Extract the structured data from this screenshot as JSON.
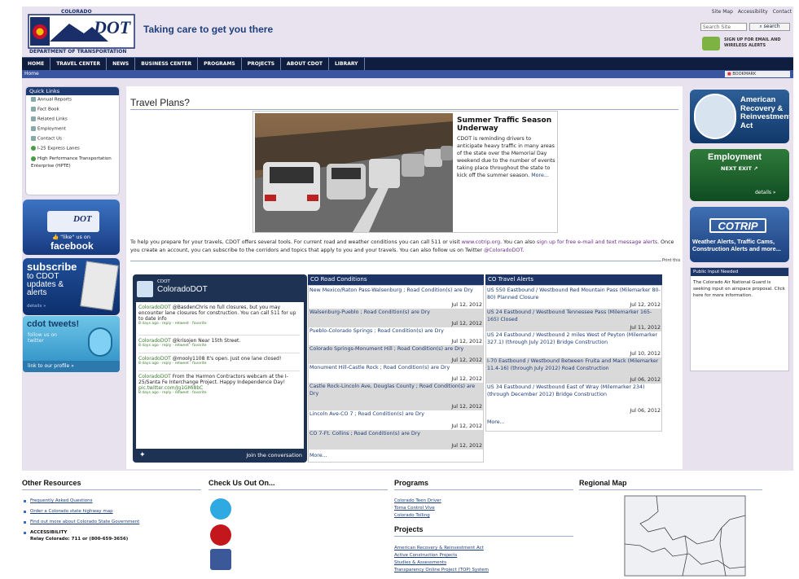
{
  "header": {
    "logo_state": "COLORADO",
    "logo_main": "DOT",
    "logo_dept": "DEPARTMENT OF TRANSPORTATION",
    "tagline": "Taking care to get you there",
    "top_links": [
      "Site Map",
      "Accessibility",
      "Contact"
    ],
    "search_placeholder": "Search Site",
    "search_button": "search",
    "signup": "SIGN UP FOR EMAIL AND WIRELESS ALERTS"
  },
  "nav": {
    "items": [
      "HOME",
      "TRAVEL CENTER",
      "NEWS",
      "BUSINESS CENTER",
      "PROGRAMS",
      "PROJECTS",
      "ABOUT CDOT",
      "LIBRARY"
    ]
  },
  "breadcrumb": {
    "home": "Home",
    "bookmark": "BOOKMARK"
  },
  "quick_links": {
    "title": "Quick Links",
    "items": [
      "Annual Reports",
      "Fact Book",
      "Related Links",
      "Employment",
      "Contact Us",
      "I-25 Express Lanes",
      "High Performance Transportation Enterprise (HPTE)"
    ]
  },
  "left_promos": {
    "facebook_line1": "\"like\" us on",
    "facebook_line2": "facebook",
    "facebook_logo": "DOT",
    "subscribe_title": "subscribe",
    "subscribe_lines": [
      "to CDOT",
      "updates &",
      "alerts"
    ],
    "subscribe_details": "details »",
    "tweets_title": "cdot tweets!",
    "tweets_sub": "follow us on twitter",
    "tweets_link": "link to our profile »"
  },
  "main": {
    "title": "Travel Plans?",
    "feature_title": "Summer Traffic Season Underway",
    "feature_text": "CDOT is reminding drivers to anticipate heavy traffic in many areas of the state over the Memorial Day weekend due to the number of events taking place throughout the state to kick off the summer season.",
    "feature_more": "More...",
    "intro_a": "To help you prepare for your travels, CDOT offers several tools. For current road and weather conditions you can call 511 or visit ",
    "intro_link1": "www.cotrip.org",
    "intro_b": ". You can also ",
    "intro_link2": "sign up for free e-mail and text message alerts",
    "intro_c": ". Once you create an account, you can subscribe to the corridors and topics that apply to you and your travels. You can also follow us on Twitter ",
    "intro_link3": "@ColoradoDOT",
    "intro_d": ".",
    "print_this": "Print this"
  },
  "twitter_widget": {
    "small": "CDOT",
    "name": "ColoradoDOT",
    "join": "Join the conversation",
    "tweets": [
      {
        "user": "ColoradoDOT",
        "text": " @BasdenChris no full closures, but you may encounter lane closures for construction. You can call 511 for up to date info",
        "meta": "8 days ago · reply · retweet · favorite"
      },
      {
        "user": "ColoradoDOT",
        "text": " @krisojen Near 15th Street.",
        "meta": "8 days ago · reply · retweet · favorite"
      },
      {
        "user": "ColoradoDOT",
        "text": " @mooly1108 It's open. Just one lane closed!",
        "meta": "8 days ago · reply · retweet · favorite"
      },
      {
        "user": "ColoradoDOT",
        "text": " From the Harmon Contractors webcam at the I-25/Santa Fe Interchange Project. Happy Independence Day! ",
        "link": "pic.twitter.com/Jg1GMi8bC",
        "meta": "8 days ago · reply · retweet · favorite"
      }
    ]
  },
  "road_conditions": {
    "title": "CO Road Conditions",
    "rows": [
      {
        "text": "New Mexico/Raton Pass-Walsenburg ; Road Condition(s) are Dry",
        "date": "Jul 12, 2012"
      },
      {
        "text": "Walsenburg-Pueblo ; Road Condition(s) are Dry",
        "date": "Jul 12, 2012"
      },
      {
        "text": "Pueblo-Colorado Springs ; Road Condition(s) are Dry",
        "date": "Jul 12, 2012"
      },
      {
        "text": "Colorado Springs-Monument Hill ; Road Condition(s) are Dry",
        "date": "Jul 12, 2012"
      },
      {
        "text": "Monument Hill-Castle Rock ; Road Condition(s) are Dry",
        "date": "Jul 12, 2012"
      },
      {
        "text": "Castle Rock-Lincoln Ave, Douglas County ; Road Condition(s) are Dry",
        "date": "Jul 12, 2012"
      },
      {
        "text": "Lincoln Ave-CO 7 ; Road Condition(s) are Dry",
        "date": "Jul 12, 2012"
      },
      {
        "text": "CO 7-Ft. Collins ; Road Condition(s) are Dry",
        "date": "Jul 12, 2012"
      }
    ],
    "more": "More..."
  },
  "travel_alerts": {
    "title": "CO Travel Alerts",
    "rows": [
      {
        "text": "US 550 Eastbound / Westbound Red Mountain Pass (Milemarker 80-80) Planned Closure",
        "date": "Jul 12, 2012"
      },
      {
        "text": "US 24 Eastbound / Westbound Tennessee Pass (Milemarker 165-165) Closed",
        "date": "Jul 11, 2012"
      },
      {
        "text": "US 24 Eastbound / Westbound 2 miles West of Peyton (Milemarker 327.1) (through July 2012) Bridge Construction",
        "date": "Jul 10, 2012"
      },
      {
        "text": "I-70 Eastbound / Westbound Between Fruita and Mack (Milemarker 11.4-16) (through July 2012) Road Construction",
        "date": "Jul 06, 2012"
      },
      {
        "text": "US 34 Eastbound / Westbound East of Wray (Milemarker 234) (through December 2012) Bridge Construction",
        "date": "Jul 06, 2012"
      }
    ],
    "more": "More..."
  },
  "right_promos": {
    "arra": [
      "American",
      "Recovery &",
      "Reinvestment",
      "Act"
    ],
    "employment": "Employment",
    "next_exit": "NEXT EXIT",
    "emp_details": "details »",
    "cotrip": "COTRIP",
    "cotrip_sub": "Weather Alerts, Traffic Cams, Construction Alerts and more...",
    "public_input_title": "Public Input Needed",
    "public_input_text": "The Colorado Air National Guard is seeking input on airspace proposal. Click here for more information."
  },
  "footer": {
    "other_title": "Other Resources",
    "other_links": [
      "Frequently Asked Questions",
      "Order a Colorado state highway map",
      "Find out more about Colorado State Government",
      "ACCESSIBILITY"
    ],
    "relay": "Relay Colorado: 711 or (800-659-3656)",
    "check_title": "Check Us Out On...",
    "programs_title": "Programs",
    "programs_links": [
      "Colorado Teen Driver",
      "Toma Control Vive",
      "Colorado Tolling"
    ],
    "projects_title": "Projects",
    "projects_links": [
      "American Recovery & Reinvestment Act",
      "Active Construction Projects",
      "Studies & Assessments",
      "Transparency Online Project (TOP) System"
    ],
    "map_title": "Regional Map"
  },
  "colors": {
    "nav": "#0f1e3e",
    "header_bg": "#e8e3ee",
    "accent": "#1c3566",
    "link": "#1d3d7a"
  }
}
